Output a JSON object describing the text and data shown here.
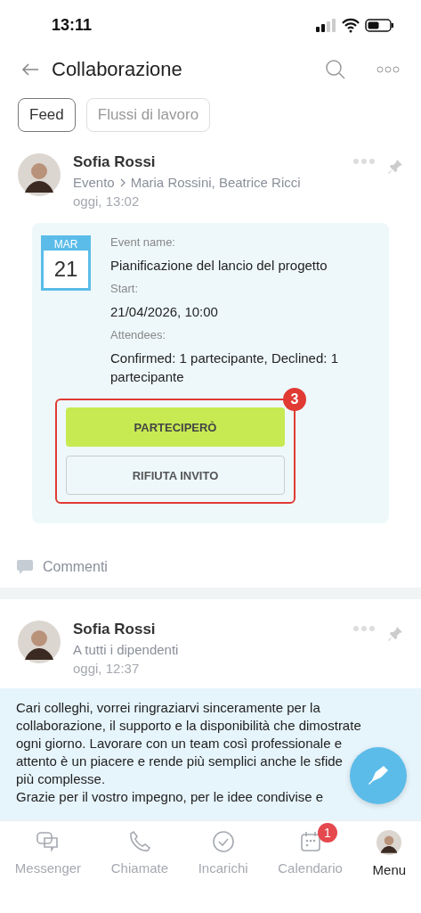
{
  "status_bar": {
    "time": "13:11"
  },
  "header": {
    "title": "Collaborazione"
  },
  "filters": [
    {
      "label": "Feed",
      "selected": true
    },
    {
      "label": "Flussi di lavoro",
      "selected": false
    }
  ],
  "posts": [
    {
      "kind": "event",
      "author": "Sofia Rossi",
      "audience": "Evento",
      "recipients": "Maria Rossini, Beatrice Ricci",
      "time": "oggi, 13:02",
      "event": {
        "month": "MAR",
        "day": "21",
        "name_label": "Event name:",
        "name": "Pianificazione del lancio del progetto",
        "start_label": "Start:",
        "start": "21/04/2026, 10:00",
        "attendees_label": "Attendees:",
        "attendees": "Confirmed: 1 partecipante, Declined: 1 partecipante",
        "badge": "3",
        "accept": "PARTECIPERÒ",
        "decline": "RIFIUTA INVITO"
      },
      "comments": "Commenti"
    },
    {
      "kind": "message",
      "author": "Sofia Rossi",
      "audience": "A tutti i dipendenti",
      "time": "oggi, 12:37",
      "paragraphs": [
        "Cari colleghi, vorrei ringraziarvi sinceramente per la collaborazione, il supporto e la disponibilità che dimostrate ogni giorno. Lavorare con un team così professionale e attento è un piacere e rende più semplici anche le sfide più complesse.",
        "Grazie per il vostro impegno, per le idee condivise e"
      ]
    }
  ],
  "tab_bar": [
    {
      "kind": "chat",
      "label": "Messenger",
      "selected": false
    },
    {
      "kind": "phone",
      "label": "Chiamate",
      "selected": false
    },
    {
      "kind": "check",
      "label": "Incarichi",
      "selected": false
    },
    {
      "kind": "calendar",
      "label": "Calendario",
      "selected": false,
      "badge": "1"
    },
    {
      "kind": "avatar",
      "label": "Menu",
      "selected": true
    }
  ]
}
